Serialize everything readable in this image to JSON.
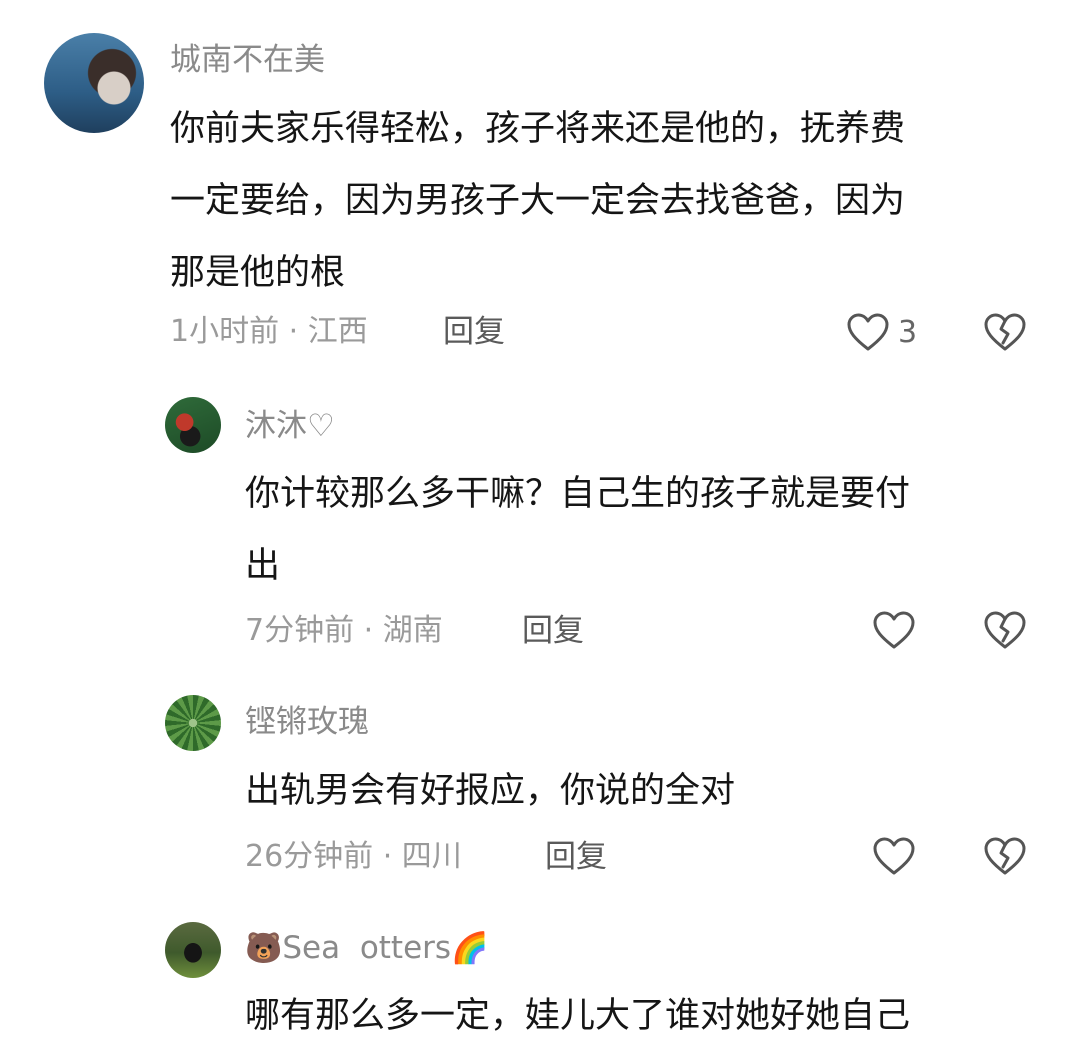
{
  "comments": [
    {
      "username": "城南不在美",
      "lines": [
        "你前夫家乐得轻松，孩子将来还是他的，抚养费",
        "一定要给，因为男孩子大一定会去找爸爸，因为",
        "那是他的根"
      ],
      "time_location": "1小时前 · 江西",
      "reply_label": "回复",
      "like_count": "3"
    },
    {
      "username": "沐沐♡",
      "lines": [
        "你计较那么多干嘛？自己生的孩子就是要付",
        "出"
      ],
      "time_location": "7分钟前 · 湖南",
      "reply_label": "回复"
    },
    {
      "username": "铿锵玫瑰",
      "lines": [
        "出轨男会有好报应，你说的全对"
      ],
      "time_location": "26分钟前 · 四川",
      "reply_label": "回复"
    },
    {
      "username_prefix_emoji": "🐻",
      "username": "Sea  otters",
      "username_suffix_emoji": "🌈",
      "lines": [
        "哪有那么多一定，娃儿大了谁对她好她自己"
      ]
    }
  ],
  "icons": {
    "like": "heart-outline-icon",
    "dislike": "broken-heart-icon"
  }
}
